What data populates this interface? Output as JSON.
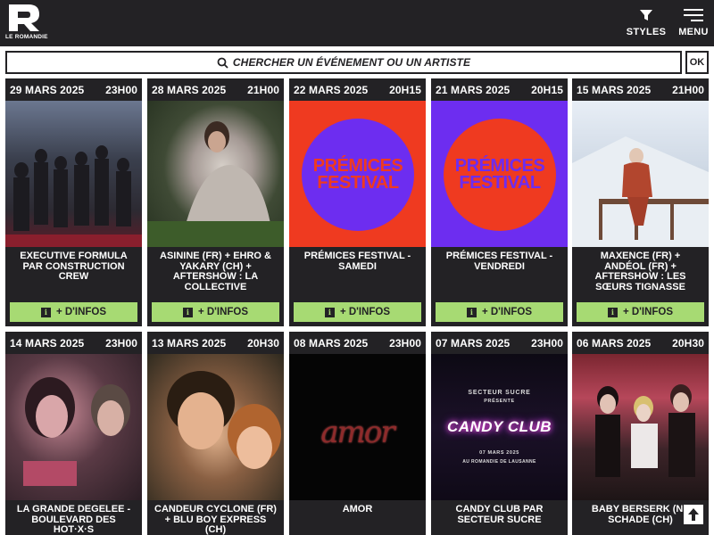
{
  "header": {
    "logo_text": "LE ROMANDIE",
    "styles_label": "STYLES",
    "menu_label": "MENU",
    "bg_color": "#232225"
  },
  "search": {
    "placeholder": "CHERCHER UN ÉVÉNEMENT OU UN ARTISTE",
    "ok_label": "OK"
  },
  "accent_color": "#a7da73",
  "events": [
    {
      "date": "29 MARS 2025",
      "time": "23H00",
      "title": "EXECUTIVE FORMULA PAR CONSTRUCTION CREW",
      "info_label": "+ D'INFOS"
    },
    {
      "date": "28 MARS 2025",
      "time": "21H00",
      "title": "ASININE (FR) + EHRO & YAKARY (CH) + AFTERSHOW : LA COLLECTIVE",
      "info_label": "+ D'INFOS"
    },
    {
      "date": "22 MARS 2025",
      "time": "20H15",
      "title": "PRÉMICES FESTIVAL - SAMEDI",
      "info_label": "+ D'INFOS",
      "poster_line1": "PRÉMICES",
      "poster_line2": "FESTIVAL"
    },
    {
      "date": "21 MARS 2025",
      "time": "20H15",
      "title": "PRÉMICES FESTIVAL - VENDREDI",
      "info_label": "+ D'INFOS",
      "poster_line1": "PRÉMICES",
      "poster_line2": "FESTIVAL"
    },
    {
      "date": "15 MARS 2025",
      "time": "21H00",
      "title": "MAXENCE (FR) + ANDÉOL (FR) + AFTERSHOW : LES SŒURS TIGNASSE",
      "info_label": "+ D'INFOS"
    },
    {
      "date": "14 MARS 2025",
      "time": "23H00",
      "title": "LA GRANDE DEGELEE - BOULEVARD DES HOT·X·S"
    },
    {
      "date": "13 MARS 2025",
      "time": "20H30",
      "title": "CANDEUR CYCLONE (FR) + BLU BOY EXPRESS (CH)"
    },
    {
      "date": "08 MARS 2025",
      "time": "23H00",
      "title": "AMOR",
      "poster_text": "amor"
    },
    {
      "date": "07 MARS 2025",
      "time": "23H00",
      "title": "CANDY CLUB PAR SECTEUR SUCRE",
      "poster_pre1": "SECTEUR SUCRE",
      "poster_pre2": "PRÉSENTE",
      "poster_logo": "CANDY CLUB",
      "poster_date": "07 MARS 2025",
      "poster_venue": "AU ROMANDIE DE LAUSANNE"
    },
    {
      "date": "06 MARS 2025",
      "time": "20H30",
      "title": "BABY BERSERK (NL SCHADE (CH)"
    }
  ]
}
